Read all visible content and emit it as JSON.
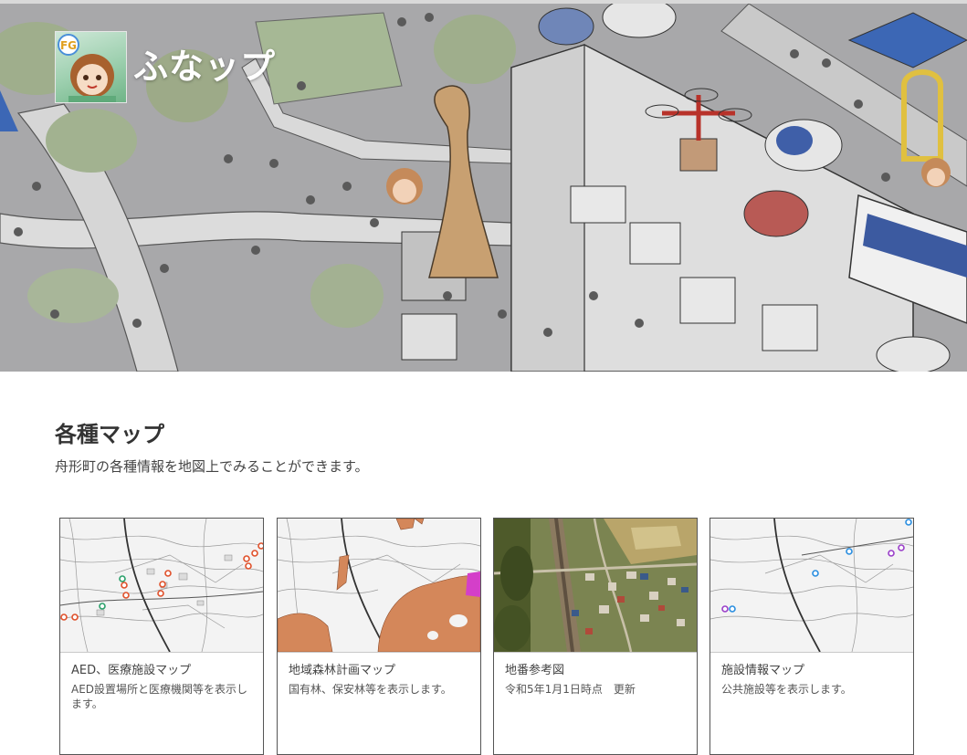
{
  "site": {
    "title": "ふなップ"
  },
  "hero": {
    "illustration": "town-illustration"
  },
  "section": {
    "heading": "各種マップ",
    "description": "舟形町の各種情報を地図上でみることができます。"
  },
  "cards": [
    {
      "title": "AED、医療施設マップ",
      "description": "AED設置場所と医療機関等を表示します。",
      "thumbnail": "topographic-map-with-red-markers"
    },
    {
      "title": "地域森林計画マップ",
      "description": "国有林、保安林等を表示します。",
      "thumbnail": "topographic-map-with-forest-areas"
    },
    {
      "title": "地番参考図",
      "description": "令和5年1月1日時点　更新",
      "thumbnail": "aerial-photo"
    },
    {
      "title": "施設情報マップ",
      "description": "公共施設等を表示します。",
      "thumbnail": "topographic-map-with-blue-markers"
    }
  ],
  "colors": {
    "aed_marker": "#e0502a",
    "forest_area": "#d4875a",
    "forest_highlight": "#d43fc9",
    "facility_marker": "#2a8ee0",
    "facility_marker_alt": "#9a3fc9"
  }
}
